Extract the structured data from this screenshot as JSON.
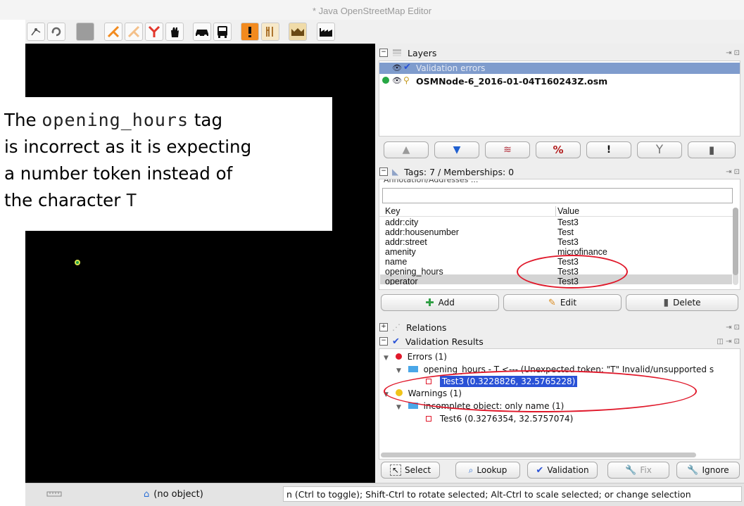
{
  "window": {
    "title": "* Java OpenStreetMap Editor"
  },
  "toolbar": {
    "icons": [
      "node-icon",
      "refresh-icon",
      "grey-square-icon",
      "turn-restriction-icon",
      "turn-restriction-2-icon",
      "turn-restriction-3-icon",
      "hand-icon",
      "car-icon",
      "bus-icon",
      "warning-icon",
      "restaurant-icon",
      "tourism-icon",
      "industrial-icon"
    ]
  },
  "callout": {
    "line1_pre": "The ",
    "line1_code": "opening_hours",
    "line1_post": " tag",
    "line2": "is incorrect as it is expecting",
    "line3": "a number token instead of",
    "line4_pre": "the character ",
    "line4_code": "T"
  },
  "layers": {
    "header": "Layers",
    "items": [
      {
        "name": "Validation errors"
      },
      {
        "name": "OSMNode-6_2016-01-04T160243Z.osm"
      }
    ]
  },
  "tags": {
    "header": "Tags: 7 / Memberships: 0",
    "preset_hint": "Annotation/Addresses ...",
    "col_key": "Key",
    "col_value": "Value",
    "rows": [
      {
        "key": "addr:city",
        "value": "Test3"
      },
      {
        "key": "addr:housenumber",
        "value": "Test"
      },
      {
        "key": "addr:street",
        "value": "Test3"
      },
      {
        "key": "amenity",
        "value": "microfinance"
      },
      {
        "key": "name",
        "value": "Test3"
      },
      {
        "key": "opening_hours",
        "value": "Test3"
      },
      {
        "key": "operator",
        "value": "Test3"
      }
    ],
    "add_label": "Add",
    "edit_label": "Edit",
    "delete_label": "Delete"
  },
  "relations": {
    "header": "Relations"
  },
  "validation": {
    "header": "Validation Results",
    "errors_label": "Errors (1)",
    "error_item": "opening_hours - T <--- (Unexpected token: \"T\" Invalid/unsupported s",
    "error_object": "Test3 (0.3228826, 32.5765228)",
    "warnings_label": "Warnings (1)",
    "warning_item": "incomplete object: only name (1)",
    "warning_object": "Test6 (0.3276354, 32.5757074)",
    "buttons": {
      "select": "Select",
      "lookup": "Lookup",
      "validation": "Validation",
      "fix": "Fix",
      "ignore": "Ignore"
    }
  },
  "statusbar": {
    "object": "(no object)",
    "hint": "n (Ctrl to toggle); Shift-Ctrl to rotate selected; Alt-Ctrl to scale selected; or change selection"
  },
  "colors": {
    "annotation_red": "#e0182a",
    "selection_blue": "#2a52d6",
    "map_bg": "#000000"
  }
}
